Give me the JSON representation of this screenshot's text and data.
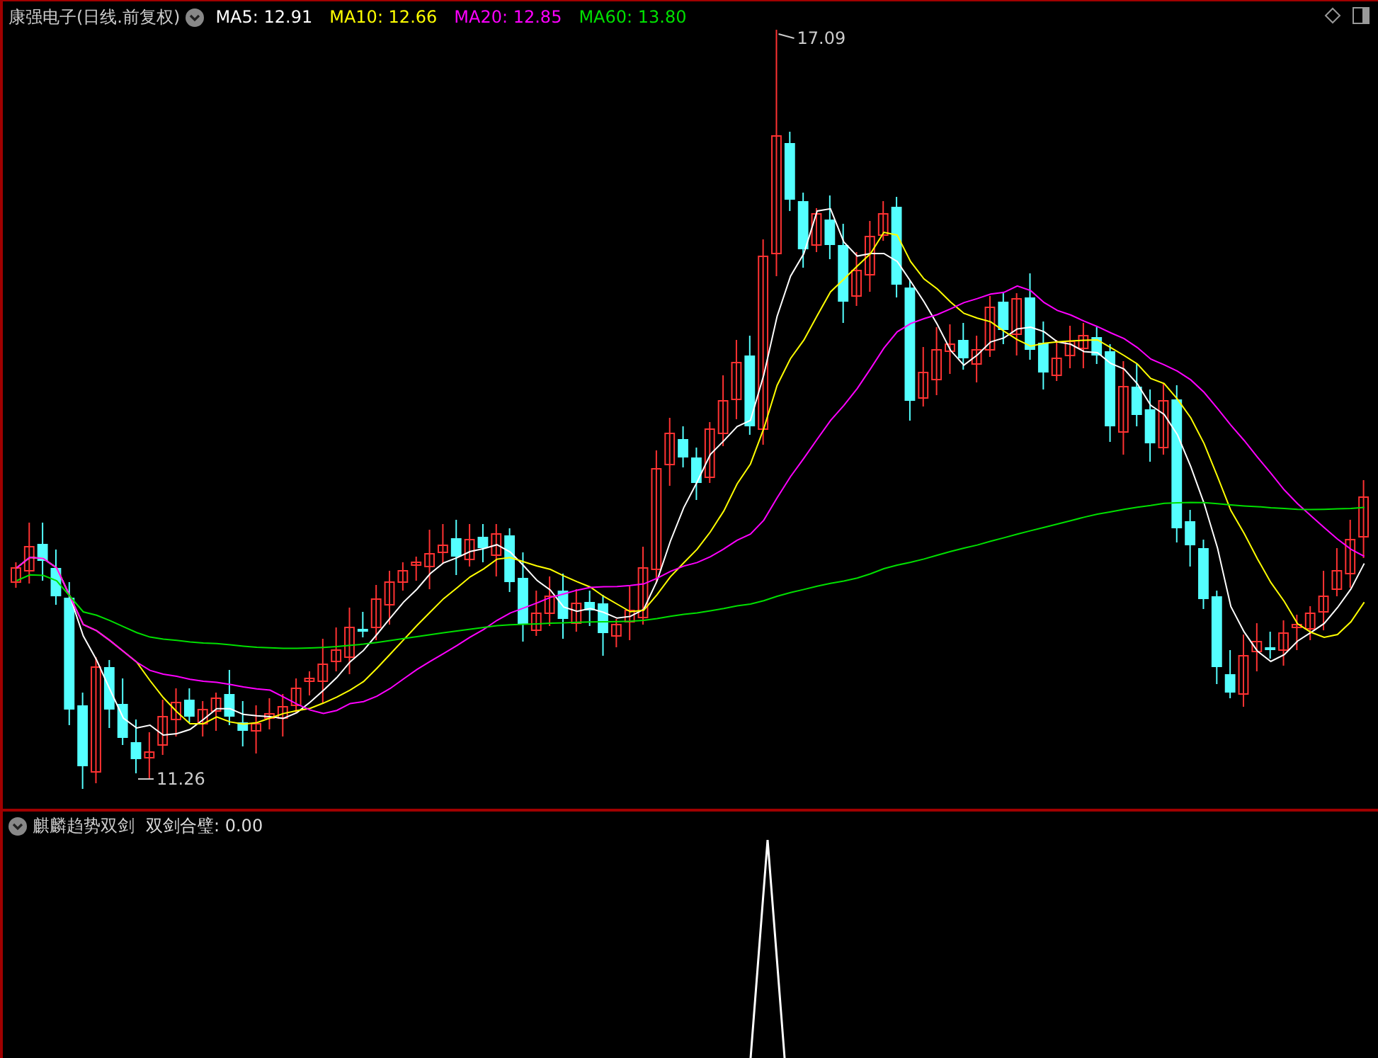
{
  "stock": {
    "name": "康强电子",
    "period": "(日线.前复权)"
  },
  "moving_averages": [
    {
      "label": "MA5: 12.91",
      "color": "#ffffff"
    },
    {
      "label": "MA10: 12.66",
      "color": "#ffff00"
    },
    {
      "label": "MA20: 12.85",
      "color": "#ff00ff"
    },
    {
      "label": "MA60: 13.80",
      "color": "#00e000"
    }
  ],
  "price_high_label": "17.09",
  "price_low_label": "11.26",
  "indicator": {
    "name": "麒麟趋势双剑",
    "legend": "双剑合璧: 0.00"
  }
}
